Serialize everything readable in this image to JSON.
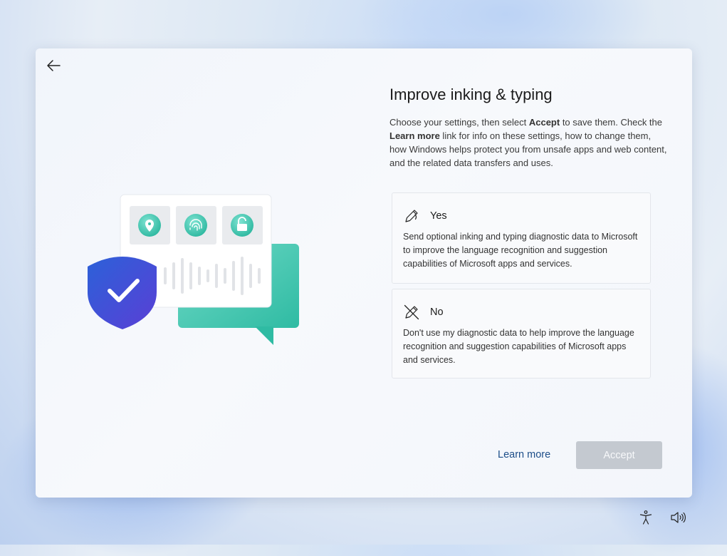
{
  "page": {
    "title": "Improve inking & typing",
    "description_parts": {
      "p1": "Choose your settings, then select ",
      "accept_bold": "Accept",
      "p2": " to save them. Check the ",
      "learn_more_bold": "Learn more",
      "p3": " link for info on these settings, how to change them, how Windows helps protect you from unsafe apps and web content, and the related data transfers and uses."
    }
  },
  "options": {
    "yes": {
      "label": "Yes",
      "text": "Send optional inking and typing diagnostic data to Microsoft to improve the language recognition and suggestion capabilities of Microsoft apps and services.",
      "icon": "pen-icon"
    },
    "no": {
      "label": "No",
      "text": "Don't use my diagnostic data to help improve the language recognition and suggestion capabilities of Microsoft apps and services.",
      "icon": "pen-off-icon"
    }
  },
  "footer": {
    "learn_more": "Learn more",
    "accept": "Accept"
  },
  "taskbar": {
    "accessibility_icon": "accessibility-icon",
    "volume_icon": "volume-icon"
  },
  "colors": {
    "accent_teal": "#3ecbb3",
    "shield_blue": "#2f52d6",
    "link": "#1d4e89",
    "button_disabled": "#c4c9d0"
  }
}
